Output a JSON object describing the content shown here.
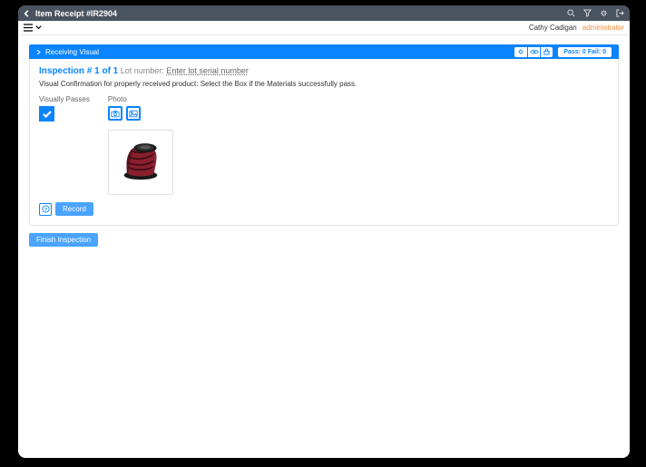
{
  "titlebar": {
    "title": "Item Receipt #IR2904"
  },
  "subbar": {
    "user": "Cathy Cadigan",
    "role": "administrator"
  },
  "bluebar": {
    "label": "Receiving Visual",
    "pass_fail": "Pass: 0 Fail: 0"
  },
  "inspection": {
    "title": "Inspection # 1 of 1",
    "lot_label": "Lot number:",
    "lot_link": "Enter lot serial number",
    "description": "Visual Confirmation for properly received product: Select the Box if the Materials successfully pass.",
    "visually_passes_label": "Visually Passes",
    "photo_label": "Photo",
    "checked": true
  },
  "buttons": {
    "record": "Record",
    "finish": "Finish Inspection"
  },
  "icons": {
    "back": "back-arrow",
    "hamburger": "hamburger",
    "chevron": "chevron-down",
    "search": "search",
    "filter": "filter",
    "gear": "gear",
    "exit": "exit",
    "settings": "gear",
    "eye": "eye",
    "lock": "lock",
    "camera": "camera",
    "image": "image",
    "help": "help"
  }
}
